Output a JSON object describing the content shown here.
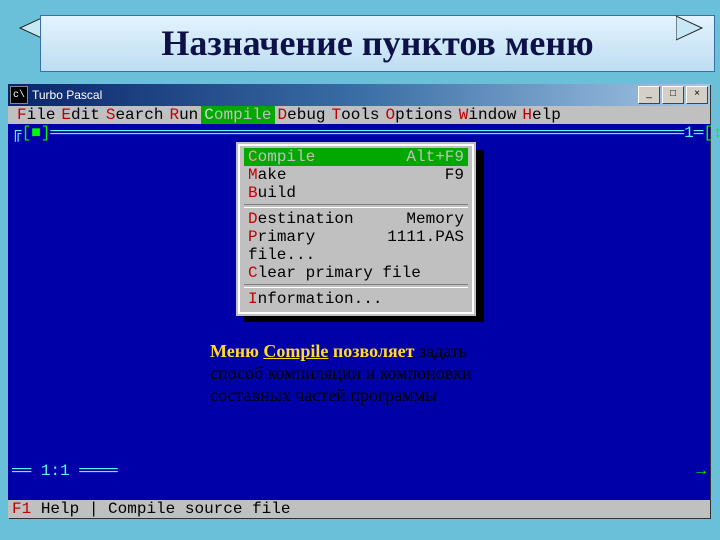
{
  "slide": {
    "title": "Назначение пунктов меню"
  },
  "window": {
    "title": "Turbo Pascal",
    "sys_icon": "c\\"
  },
  "menubar": {
    "items": [
      {
        "hot": "F",
        "rest": "ile"
      },
      {
        "hot": "E",
        "rest": "dit"
      },
      {
        "hot": "S",
        "rest": "earch"
      },
      {
        "hot": "R",
        "rest": "un"
      },
      {
        "hot": "C",
        "rest": "ompile",
        "active": true
      },
      {
        "hot": "D",
        "rest": "ebug"
      },
      {
        "hot": "T",
        "rest": "ools"
      },
      {
        "hot": "O",
        "rest": "ptions"
      },
      {
        "hot": "W",
        "rest": "indow"
      },
      {
        "hot": "H",
        "rest": "elp"
      }
    ]
  },
  "dropdown": {
    "items1": [
      {
        "hot": "C",
        "rest": "ompile",
        "shortcut": "Alt+F9",
        "selected": true
      },
      {
        "hot": "M",
        "rest": "ake",
        "shortcut": "F9"
      },
      {
        "hot": "B",
        "rest": "uild",
        "shortcut": ""
      }
    ],
    "items2": [
      {
        "hot": "D",
        "rest": "estination",
        "shortcut": "Memory"
      },
      {
        "hot": "P",
        "rest": "rimary file...",
        "shortcut": "1111.PAS"
      },
      {
        "hot": "C",
        "rest": "lear primary file",
        "shortcut": ""
      }
    ],
    "items3": [
      {
        "hot": "I",
        "rest": "nformation...",
        "shortcut": ""
      }
    ]
  },
  "editor": {
    "window_number": "1",
    "cursor": "1:1"
  },
  "statusbar": {
    "key": "F1",
    "label": "Help",
    "sep": "|",
    "hint": "Compile source file"
  },
  "caption": {
    "lead_prefix": "Меню ",
    "lead_link": "Compile",
    "lead_suffix": " позволяет",
    "body": " задать способ компиляции и компоновки составных частей программы"
  }
}
